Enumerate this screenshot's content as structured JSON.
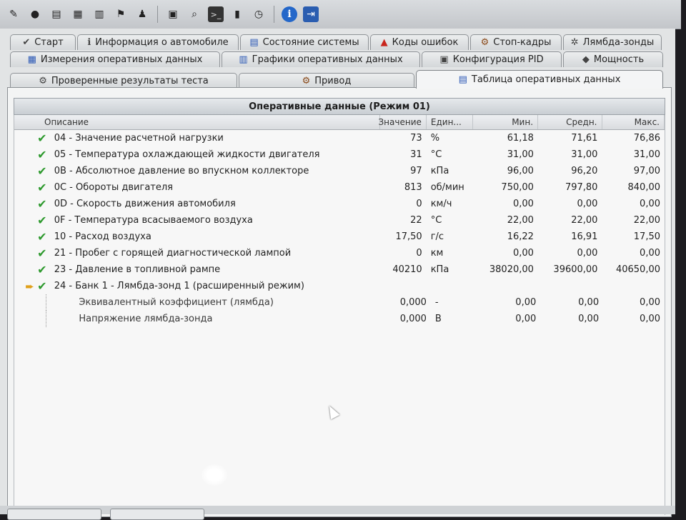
{
  "toolbar": {
    "icons": [
      "edit-icon",
      "disc-icon",
      "document-icon",
      "grid-icon",
      "chart-icon",
      "run-icon",
      "person-icon",
      "clipboard-icon",
      "search-icon",
      "terminal-icon",
      "phone-icon",
      "clock-icon",
      "info-icon",
      "exit-icon"
    ]
  },
  "tabs": {
    "row1": [
      {
        "label": "Старт",
        "icon": "check-icon"
      },
      {
        "label": "Информация о автомобиле",
        "icon": "info-icon"
      },
      {
        "label": "Состояние системы",
        "icon": "report-icon"
      },
      {
        "label": "Коды ошибок",
        "icon": "warning-icon"
      },
      {
        "label": "Стоп-кадры",
        "icon": "engine-icon"
      },
      {
        "label": "Лямбда-зонды",
        "icon": "sensor-icon"
      }
    ],
    "row2": [
      {
        "label": "Измерения оперативных данных",
        "icon": "table-icon"
      },
      {
        "label": "Графики оперативных данных",
        "icon": "chart-icon"
      },
      {
        "label": "Конфигурация PID",
        "icon": "config-icon"
      },
      {
        "label": "Мощность",
        "icon": "dyno-icon"
      }
    ],
    "row3": [
      {
        "label": "Проверенные результаты теста",
        "icon": "gear-icon"
      },
      {
        "label": "Привод",
        "icon": "engine-icon"
      },
      {
        "label": "Таблица оперативных данных",
        "icon": "table-icon",
        "active": true
      }
    ]
  },
  "grid": {
    "title": "Оперативные данные (Режим 01)",
    "columns": {
      "desc": "Описание",
      "value": "Значение",
      "unit": "Един...",
      "min": "Мин.",
      "avg": "Средн.",
      "max": "Макс."
    },
    "rows": [
      {
        "desc": "04 - Значение расчетной нагрузки",
        "value": "73",
        "unit": "%",
        "min": "61,18",
        "avg": "71,61",
        "max": "76,86",
        "check": true
      },
      {
        "desc": "05 - Температура охлаждающей жидкости двигателя",
        "value": "31",
        "unit": "°C",
        "min": "31,00",
        "avg": "31,00",
        "max": "31,00",
        "check": true
      },
      {
        "desc": "0B - Абсолютное давление во впускном коллекторе",
        "value": "97",
        "unit": "кПа",
        "min": "96,00",
        "avg": "96,20",
        "max": "97,00",
        "check": true
      },
      {
        "desc": "0C - Обороты двигателя",
        "value": "813",
        "unit": "об/мин",
        "min": "750,00",
        "avg": "797,80",
        "max": "840,00",
        "check": true
      },
      {
        "desc": "0D - Скорость движения автомобиля",
        "value": "0",
        "unit": "км/ч",
        "min": "0,00",
        "avg": "0,00",
        "max": "0,00",
        "check": true
      },
      {
        "desc": "0F - Температура всасываемого воздуха",
        "value": "22",
        "unit": "°C",
        "min": "22,00",
        "avg": "22,00",
        "max": "22,00",
        "check": true
      },
      {
        "desc": "10 - Расход воздуха",
        "value": "17,50",
        "unit": "г/с",
        "min": "16,22",
        "avg": "16,91",
        "max": "17,50",
        "check": true
      },
      {
        "desc": "21 - Пробег с горящей диагностической лампой",
        "value": "0",
        "unit": "км",
        "min": "0,00",
        "avg": "0,00",
        "max": "0,00",
        "check": true
      },
      {
        "desc": "23 - Давление в топливной рампе",
        "value": "40210",
        "unit": "кПа",
        "min": "38020,00",
        "avg": "39600,00",
        "max": "40650,00",
        "check": true
      },
      {
        "desc": "24 - Банк 1 - Лямбда-зонд 1 (расширенный режим)",
        "value": "",
        "unit": "",
        "min": "",
        "avg": "",
        "max": "",
        "check": true,
        "selected": true
      },
      {
        "desc": "Эквивалентный коэффициент (лямбда)",
        "value": "0,000",
        "unit": "-",
        "min": "0,00",
        "avg": "0,00",
        "max": "0,00",
        "sub": true
      },
      {
        "desc": "Напряжение лямбда-зонда",
        "value": "0,000",
        "unit": "В",
        "min": "0,00",
        "avg": "0,00",
        "max": "0,00",
        "sub": true
      }
    ]
  },
  "colors": {
    "check": "#2f9a2f",
    "arrow": "#e0a01a",
    "warning": "#c8251c"
  }
}
